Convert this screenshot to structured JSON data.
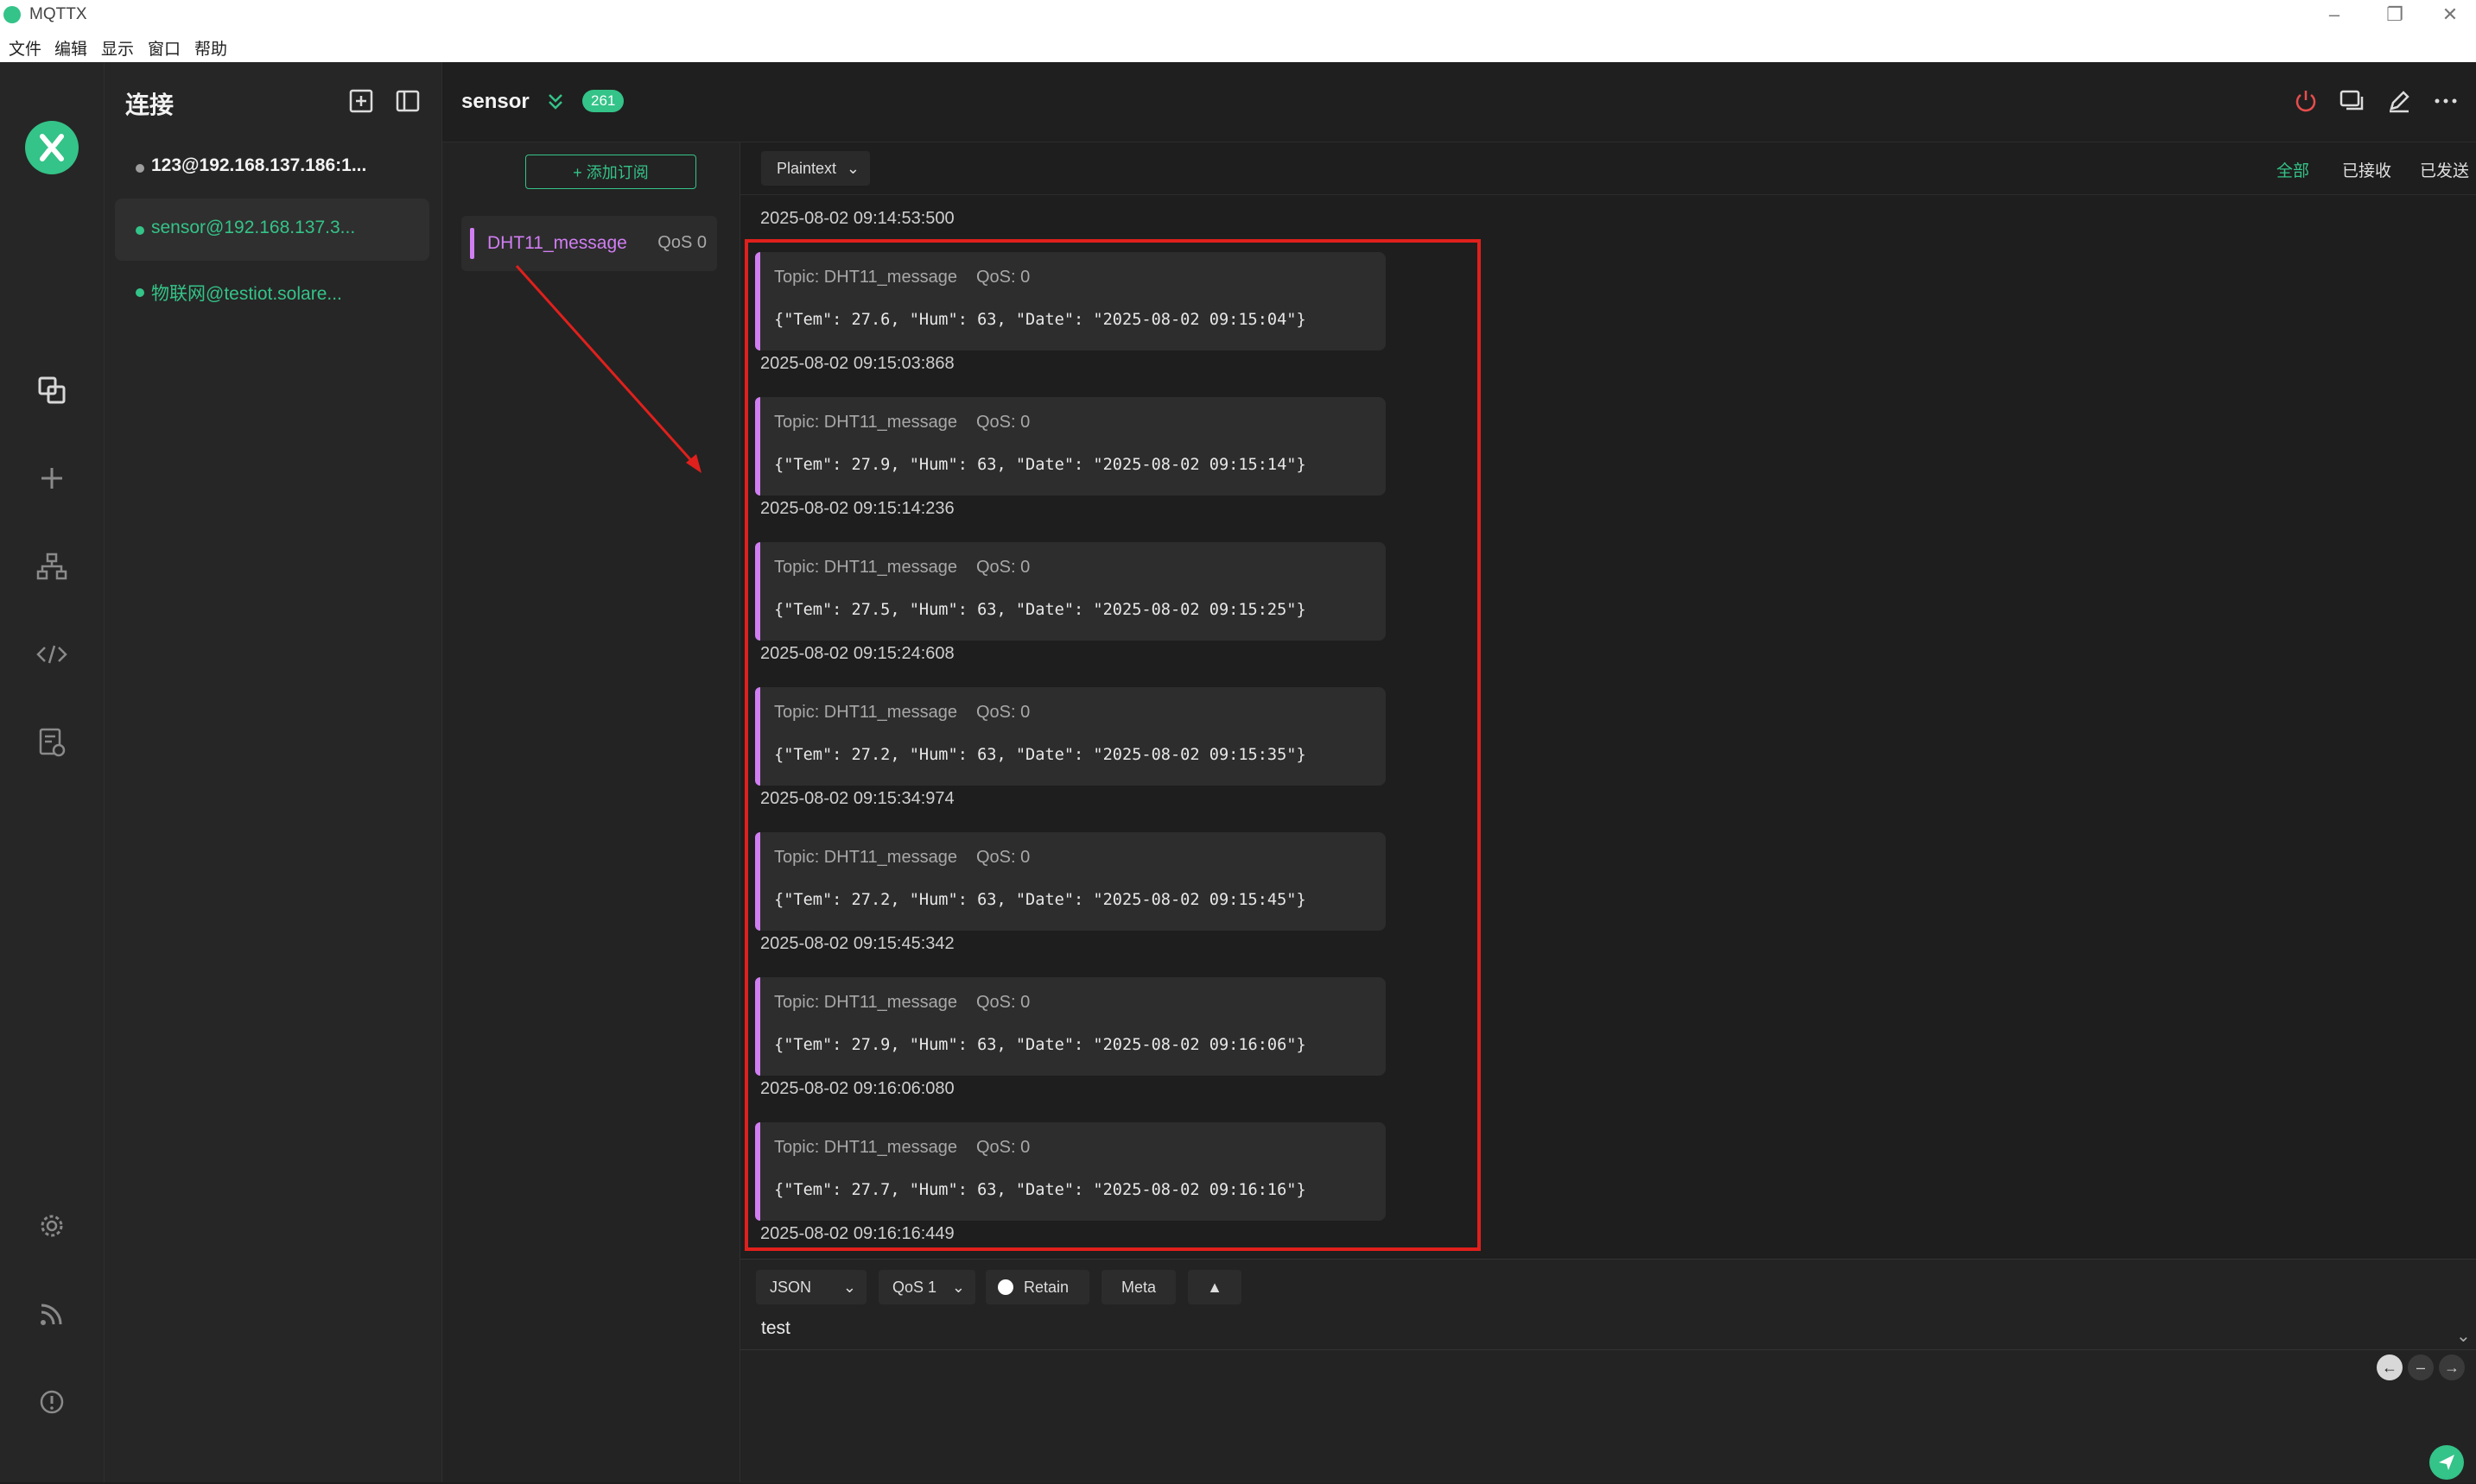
{
  "window": {
    "title": "MQTTX"
  },
  "menu": [
    "文件",
    "编辑",
    "显示",
    "窗口",
    "帮助"
  ],
  "sidebar": {
    "heading": "连接",
    "connections": [
      {
        "label": "123@192.168.137.186:1...",
        "status_color": "#9e9e9e"
      },
      {
        "label": "sensor@192.168.137.3...",
        "status_color": "#34c388"
      },
      {
        "label": "物联网@testiot.solare...",
        "status_color": "#34c388"
      }
    ]
  },
  "header": {
    "connection_name": "sensor",
    "message_count": "261"
  },
  "subscriptions": {
    "add_label": "添加订阅",
    "items": [
      {
        "topic": "DHT11_message",
        "qos": "QoS 0",
        "color": "#d17ef2"
      }
    ]
  },
  "messages": {
    "format": "Plaintext",
    "filters": {
      "all": "全部",
      "received": "已接收",
      "sent": "已发送"
    },
    "first_timestamp": "2025-08-02 09:14:53:500",
    "list": [
      {
        "topic": "Topic: DHT11_message",
        "qos": "QoS: 0",
        "payload": "{\"Tem\": 27.6, \"Hum\": 63, \"Date\": \"2025-08-02 09:15:04\"}",
        "time": "2025-08-02 09:15:03:868"
      },
      {
        "topic": "Topic: DHT11_message",
        "qos": "QoS: 0",
        "payload": "{\"Tem\": 27.9, \"Hum\": 63, \"Date\": \"2025-08-02 09:15:14\"}",
        "time": "2025-08-02 09:15:14:236"
      },
      {
        "topic": "Topic: DHT11_message",
        "qos": "QoS: 0",
        "payload": "{\"Tem\": 27.5, \"Hum\": 63, \"Date\": \"2025-08-02 09:15:25\"}",
        "time": "2025-08-02 09:15:24:608"
      },
      {
        "topic": "Topic: DHT11_message",
        "qos": "QoS: 0",
        "payload": "{\"Tem\": 27.2, \"Hum\": 63, \"Date\": \"2025-08-02 09:15:35\"}",
        "time": "2025-08-02 09:15:34:974"
      },
      {
        "topic": "Topic: DHT11_message",
        "qos": "QoS: 0",
        "payload": "{\"Tem\": 27.2, \"Hum\": 63, \"Date\": \"2025-08-02 09:15:45\"}",
        "time": "2025-08-02 09:15:45:342"
      },
      {
        "topic": "Topic: DHT11_message",
        "qos": "QoS: 0",
        "payload": "{\"Tem\": 27.9, \"Hum\": 63, \"Date\": \"2025-08-02 09:16:06\"}",
        "time": "2025-08-02 09:16:06:080"
      },
      {
        "topic": "Topic: DHT11_message",
        "qos": "QoS: 0",
        "payload": "{\"Tem\": 27.7, \"Hum\": 63, \"Date\": \"2025-08-02 09:16:16\"}",
        "time": "2025-08-02 09:16:16:449"
      }
    ]
  },
  "composer": {
    "payload_type": "JSON",
    "qos": "QoS 1",
    "retain_label": "Retain",
    "meta_label": "Meta",
    "text": "test"
  },
  "colors": {
    "accent": "#34c388",
    "topic": "#d17ef2",
    "highlight": "#e0201c",
    "disconnect": "#e84d4d"
  }
}
